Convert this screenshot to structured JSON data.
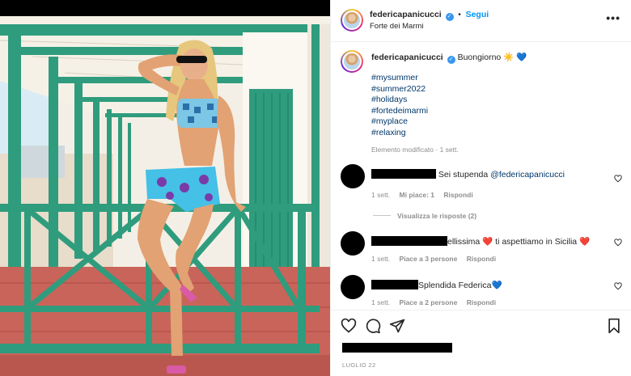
{
  "post": {
    "username": "federicapanicucci",
    "follow_label": "Segui",
    "location": "Forte dei Marmi",
    "caption_text": "Buongiorno ☀️ 💙",
    "hashtags": [
      "#mysummer",
      "#summer2022",
      "#holidays",
      "#fortedeimarmi",
      "#myplace",
      "#relaxing"
    ],
    "edited_meta": "Elemento modificato · 1 sett.",
    "date": "LUGLIO 22"
  },
  "comments": [
    {
      "text": "Sei stupenda",
      "mention": "@federicapanicucci",
      "time": "1 sett.",
      "likes": "Mi piace: 1",
      "reply": "Rispondi",
      "view_replies": "Visualizza le risposte (2)"
    },
    {
      "text": "ellissima ❤️ ti aspettiamo in Sicilia ❤️",
      "time": "1 sett.",
      "likes": "Piace a 3 persone",
      "reply": "Rispondi"
    },
    {
      "text": "Splendida Federica💙",
      "time": "1 sett.",
      "likes": "Piace a 2 persone",
      "reply": "Rispondi"
    }
  ],
  "icons": {
    "more": "more-options-icon",
    "heart": "heart-icon",
    "comment": "comment-icon",
    "share": "share-icon",
    "save": "bookmark-icon",
    "verified": "verified-badge-icon"
  },
  "colors": {
    "accent": "#0095f6",
    "link": "#00376b",
    "muted": "#8e8e8e",
    "cabin_green": "#2a9a7a",
    "deck_red": "#c9645a"
  }
}
